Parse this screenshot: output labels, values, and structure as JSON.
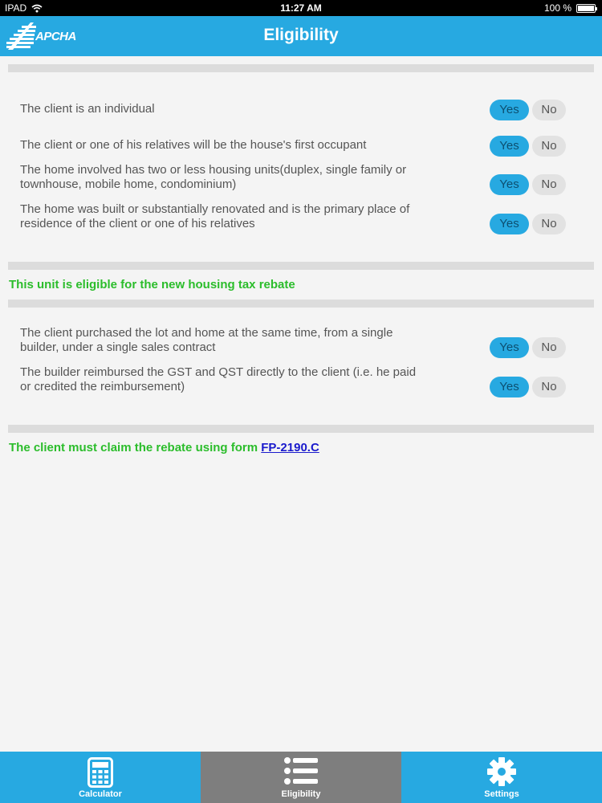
{
  "status_bar": {
    "carrier": "IPAD",
    "time": "11:27 AM",
    "battery": "100 %"
  },
  "header": {
    "logo_text": "APCHA",
    "title": "Eligibility"
  },
  "section1": {
    "questions": [
      {
        "text": "The client is an individual",
        "yes": "Yes",
        "no": "No",
        "selected": "Yes"
      },
      {
        "text": "The client or one of his relatives will be the house's first occupant",
        "yes": "Yes",
        "no": "No",
        "selected": "Yes"
      },
      {
        "text": "The home involved has two or less housing units(duplex, single family or townhouse, mobile home, condominium)",
        "yes": "Yes",
        "no": "No",
        "selected": "Yes"
      },
      {
        "text": "The home was built or substantially renovated and is the primary place of residence of the client or one of his relatives",
        "yes": "Yes",
        "no": "No",
        "selected": "Yes"
      }
    ],
    "result": "This unit is eligible for the new housing tax rebate"
  },
  "section2": {
    "questions": [
      {
        "text": "The client purchased the lot and home at the same time, from a single builder, under a single sales contract",
        "yes": "Yes",
        "no": "No",
        "selected": "Yes"
      },
      {
        "text": "The builder reimbursed the GST and QST directly to the client (i.e. he paid or credited the reimbursement)",
        "yes": "Yes",
        "no": "No",
        "selected": "Yes"
      }
    ],
    "result_prefix": "The client must claim the rebate using form",
    "result_link": "FP-2190.C"
  },
  "tabs": [
    {
      "label": "Calculator",
      "icon": "calculator-icon",
      "active": false
    },
    {
      "label": "Eligibility",
      "icon": "list-icon",
      "active": true
    },
    {
      "label": "Settings",
      "icon": "gear-icon",
      "active": false
    }
  ],
  "colors": {
    "accent": "#27a9e1",
    "success": "#2bbd2b",
    "link": "#1a1acc",
    "tab_active": "#7e7e7e"
  }
}
